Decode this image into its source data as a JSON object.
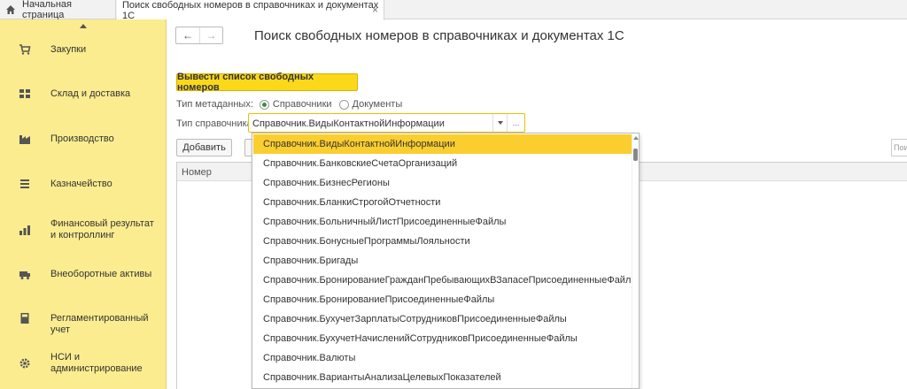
{
  "tabs": {
    "home_label": "Начальная страница",
    "active_label": "Поиск свободных номеров в  справочниках и документах 1С",
    "close_glyph": "×"
  },
  "sidebar": {
    "items": [
      {
        "label": "Закупки",
        "icon": "cart-icon"
      },
      {
        "label": "Склад и доставка",
        "icon": "warehouse-icon"
      },
      {
        "label": "Производство",
        "icon": "factory-icon"
      },
      {
        "label": "Казначейство",
        "icon": "treasury-icon"
      },
      {
        "label": "Финансовый результат и контроллинг",
        "icon": "chart-icon"
      },
      {
        "label": "Внеоборотные активы",
        "icon": "assets-icon"
      },
      {
        "label": "Регламентированный учет",
        "icon": "calculator-icon"
      },
      {
        "label": "НСИ и администрирование",
        "icon": "gear-icon"
      }
    ]
  },
  "main": {
    "nav_back": "←",
    "nav_forward": "→",
    "title": "Поиск свободных номеров в  справочниках и документах 1С",
    "primary_button": "Вывести список свободных номеров",
    "meta_type_label": "Тип метаданных:",
    "meta_option_catalogs": "Справочники",
    "meta_option_documents": "Документы",
    "catalog_type_label": "Тип справочника:",
    "catalog_type_value": "Справочник.ВидыКонтактнойИнформации",
    "combo_more": "...",
    "add_button": "Добавить",
    "search_placeholder": "Пои",
    "table_column_number": "Номер"
  },
  "dropdown": {
    "items": [
      "Справочник.ВидыКонтактнойИнформации",
      "Справочник.БанковскиеСчетаОрганизаций",
      "Справочник.БизнесРегионы",
      "Справочник.БланкиСтрогойОтчетности",
      "Справочник.БольничныйЛистПрисоединенныеФайлы",
      "Справочник.БонусныеПрограммыЛояльности",
      "Справочник.Бригады",
      "Справочник.БронированиеГражданПребывающихВЗапасеПрисоединенныеФайлы",
      "Справочник.БронированиеПрисоединенныеФайлы",
      "Справочник.БухучетЗарплатыСотрудниковПрисоединенныеФайлы",
      "Справочник.БухучетНачисленийСотрудниковПрисоединенныеФайлы",
      "Справочник.Валюты",
      "Справочник.ВариантыАнализаЦелевыхПоказателей"
    ]
  },
  "colors": {
    "sidebar_bg": "#fbec8f",
    "accent_button": "#fbd81a",
    "selected_item": "#fbce2f",
    "radio_on": "#3c8f3c"
  }
}
